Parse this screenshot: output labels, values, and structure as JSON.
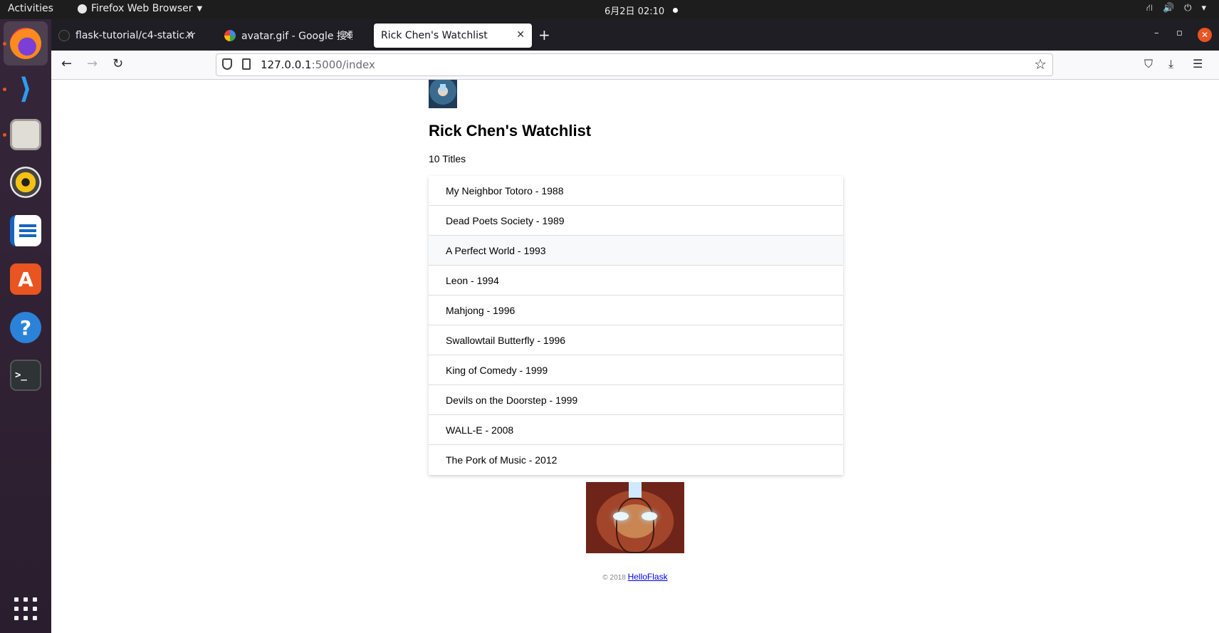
{
  "topbar": {
    "activities": "Activities",
    "app_menu": "Firefox Web Browser",
    "clock": "6月2日  02:10"
  },
  "dock": {
    "items": [
      "firefox-icon",
      "vscode-icon",
      "files-icon",
      "rhythmbox-icon",
      "writer-icon",
      "app-store-icon",
      "help-icon",
      "terminal-icon"
    ]
  },
  "browser": {
    "tabs": [
      {
        "label": "flask-tutorial/c4-static.md"
      },
      {
        "label": "avatar.gif - Google 搜尋"
      },
      {
        "label": "Rick Chen's Watchlist"
      }
    ],
    "url_host": "127.0.0.1",
    "url_rest": ":5000/index"
  },
  "page": {
    "title": "Rick Chen's Watchlist",
    "count_text": "10 Titles",
    "movies": [
      "My Neighbor Totoro - 1988",
      "Dead Poets Society - 1989",
      "A Perfect World - 1993",
      "Leon - 1994",
      "Mahjong - 1996",
      "Swallowtail Butterfly - 1996",
      "King of Comedy - 1999",
      "Devils on the Doorstep - 1999",
      "WALL-E - 2008",
      "The Pork of Music - 2012"
    ],
    "footer_text": "© 2018 ",
    "footer_link": "HelloFlask"
  },
  "colors": {
    "accent": "#e95420",
    "dock_bg": "#2f2233",
    "tabstrip_bg": "#1f1e25"
  }
}
